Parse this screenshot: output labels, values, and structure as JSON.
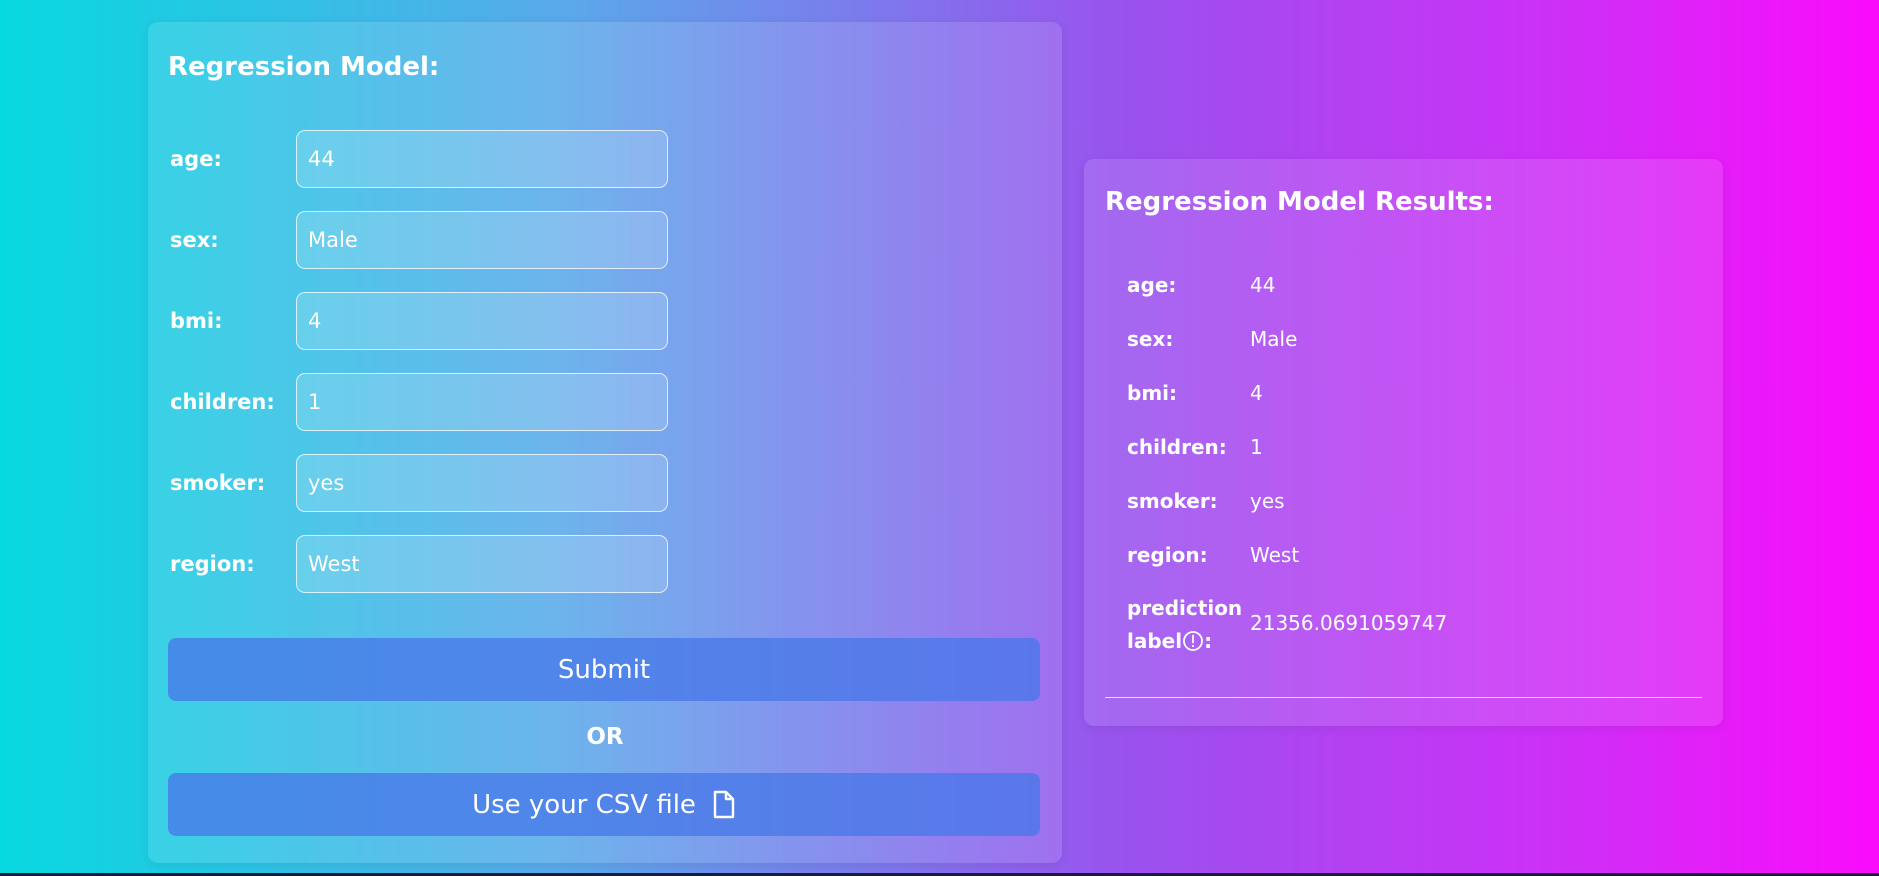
{
  "form": {
    "title": "Regression Model:",
    "fields": [
      {
        "label": "age:",
        "value": "44"
      },
      {
        "label": "sex:",
        "value": "Male"
      },
      {
        "label": "bmi:",
        "value": "4"
      },
      {
        "label": "children:",
        "value": "1"
      },
      {
        "label": "smoker:",
        "value": "yes"
      },
      {
        "label": "region:",
        "value": "West"
      }
    ],
    "submit_label": "Submit",
    "or_label": "OR",
    "csv_label": "Use your CSV file",
    "csv_icon": "file-icon"
  },
  "results": {
    "title": "Regression Model Results:",
    "rows": [
      {
        "label": "age:",
        "value": "44"
      },
      {
        "label": "sex:",
        "value": "Male"
      },
      {
        "label": "bmi:",
        "value": "4"
      },
      {
        "label": "children:",
        "value": "1"
      },
      {
        "label": "smoker:",
        "value": "yes"
      },
      {
        "label": "region:",
        "value": "West"
      }
    ],
    "prediction": {
      "label_line1": "prediction",
      "label_line2": "label",
      "label_suffix": ":",
      "icon": "info-icon",
      "value": "21356.0691059747"
    }
  },
  "colors": {
    "gradient_start": "#07d9e0",
    "gradient_end": "#fb0bfb",
    "button": "#4878e8",
    "text": "#ffffff"
  }
}
